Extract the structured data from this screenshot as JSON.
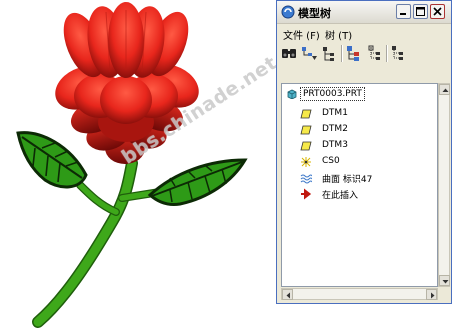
{
  "window": {
    "title": "模型树",
    "menu": [
      {
        "label": "文件 (F)"
      },
      {
        "label": "树 (T)"
      }
    ]
  },
  "tree": {
    "root": "PRT0003.PRT",
    "items": [
      {
        "label": "DTM1",
        "icon": "datum-plane-icon"
      },
      {
        "label": "DTM2",
        "icon": "datum-plane-icon"
      },
      {
        "label": "DTM3",
        "icon": "datum-plane-icon"
      },
      {
        "label": "CS0",
        "icon": "coordinate-system-icon"
      },
      {
        "label": "曲面 标识47",
        "icon": "surface-icon"
      },
      {
        "label": "在此插入",
        "icon": "insert-here-arrow-icon"
      }
    ]
  },
  "watermark": "bbs.chinade.net",
  "colors": {
    "petal": "#e8261c",
    "petal_dark": "#8a0d0a",
    "stem": "#3ea81a",
    "leaf": "#2e9a17",
    "window_border": "#4a6fbf"
  }
}
